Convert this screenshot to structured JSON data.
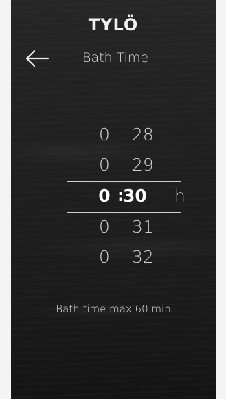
{
  "app": {
    "brand": "TYLÖ",
    "title": "Bath Time"
  },
  "picker": {
    "rows": [
      {
        "hours": "0",
        "minutes": "28"
      },
      {
        "hours": "0",
        "minutes": "29"
      },
      {
        "hours": "0",
        "minutes": "30"
      },
      {
        "hours": "0",
        "minutes": "31"
      },
      {
        "hours": "0",
        "minutes": "32"
      }
    ],
    "selected_index": 2,
    "separator": ":",
    "unit": "h"
  },
  "note": "Bath time max 60 min",
  "icons": {
    "back": "arrow-left-icon"
  },
  "colors": {
    "background": "#202020",
    "text": "#e6e6e6",
    "selected_text": "#ffffff"
  }
}
